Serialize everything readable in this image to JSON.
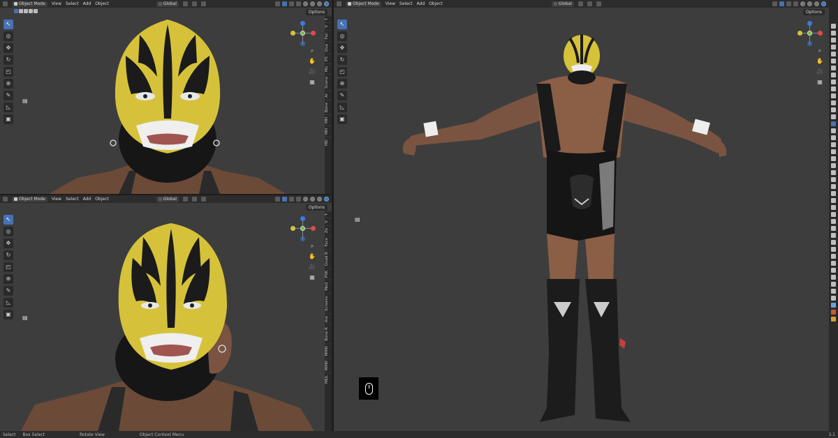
{
  "app": {
    "colors": {
      "accent": "#4772b3",
      "viewport_bg": "#3d3d3d",
      "header_bg": "#2c2c2c",
      "mask_yellow": "#d6c23a",
      "mask_black": "#1b1b1b",
      "skin": "#8a5f45"
    }
  },
  "viewports": [
    {
      "id": "top-left",
      "header": {
        "mode": "Object Mode",
        "menus": [
          "View",
          "Select",
          "Add",
          "Object"
        ],
        "orientation": "Global"
      },
      "options": "Options",
      "ntabs": [
        "T",
        "V",
        "Fac",
        "Qua",
        "PS",
        "Mo",
        "Scene",
        "Ar",
        "Bone",
        "MH",
        "MH",
        "MD"
      ]
    },
    {
      "id": "bottom-left",
      "header": {
        "mode": "Object Mode",
        "menus": [
          "View",
          "Select",
          "Add",
          "Object"
        ],
        "orientation": "Global"
      },
      "options": "Options",
      "ntabs": [
        "T",
        "V",
        "Ze",
        "Face",
        "Quad R",
        "PSK",
        "Mod",
        "Screenc",
        "Are",
        "Bone R",
        "MHW",
        "MHW",
        "MDL"
      ]
    },
    {
      "id": "right",
      "header": {
        "mode": "Object Mode",
        "menus": [
          "View",
          "Select",
          "Add",
          "Object"
        ],
        "orientation": "Global"
      },
      "options": "Options"
    }
  ],
  "toolbar_icons": [
    "cursor-select-icon",
    "cursor-3d-icon",
    "move-icon",
    "rotate-icon",
    "scale-icon",
    "transform-icon",
    "annotate-icon",
    "measure-icon",
    "add-cube-icon"
  ],
  "navigation_icons": [
    "zoom-icon",
    "hand-pan-icon",
    "camera-icon",
    "grid-ortho-icon"
  ],
  "status_bar": {
    "items": [
      "Select",
      "Box Select",
      "Rotate View",
      "Object Context Menu"
    ],
    "version": "3.1"
  }
}
